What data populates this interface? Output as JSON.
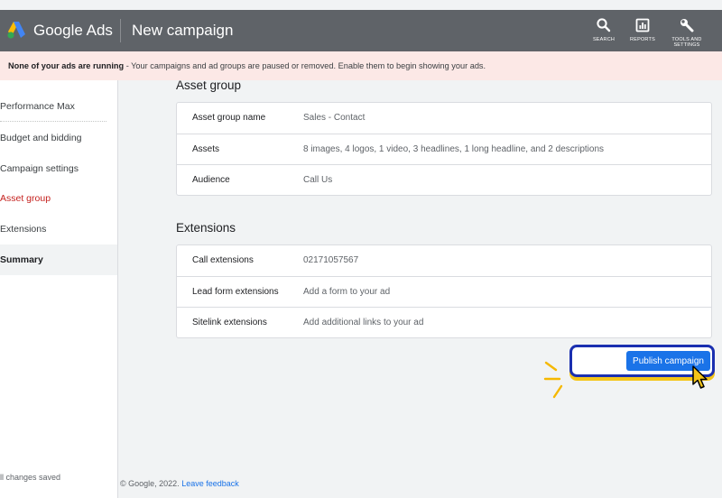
{
  "header": {
    "brand": "Google Ads",
    "page_title": "New campaign",
    "tools": [
      {
        "icon": "search-icon",
        "label": "SEARCH"
      },
      {
        "icon": "reports-icon",
        "label": "REPORTS"
      },
      {
        "icon": "wrench-icon",
        "label_line1": "TOOLS AND",
        "label_line2": "SETTINGS"
      }
    ]
  },
  "banner": {
    "bold": "None of your ads are running",
    "text": " - Your campaigns and ad groups are paused or removed. Enable them to begin showing your ads."
  },
  "sidebar": {
    "items": [
      {
        "label": "Performance Max"
      },
      {
        "label": "Budget and bidding"
      },
      {
        "label": "Campaign settings"
      },
      {
        "label": "Asset group"
      },
      {
        "label": "Extensions"
      },
      {
        "label": "Summary"
      }
    ],
    "saved": "ll changes saved"
  },
  "asset_group": {
    "title": "Asset group",
    "rows": [
      {
        "key": "Asset group name",
        "value": "Sales - Contact"
      },
      {
        "key": "Assets",
        "value": "8 images, 4 logos, 1 video, 3 headlines, 1 long headline, and 2 descriptions"
      },
      {
        "key": "Audience",
        "value": "Call Us"
      }
    ]
  },
  "extensions": {
    "title": "Extensions",
    "rows": [
      {
        "key": "Call extensions",
        "value": "02171057567"
      },
      {
        "key": "Lead form extensions",
        "value": "Add a form to your ad"
      },
      {
        "key": "Sitelink extensions",
        "value": "Add additional links to your ad"
      }
    ]
  },
  "publish_label": "Publish campaign",
  "footer": {
    "copyright": "© Google, 2022.",
    "link": "Leave feedback"
  },
  "colors": {
    "topbar": "#5f6368",
    "banner": "#fce8e6",
    "primary": "#1a73e8",
    "active_nav": "#c5221f",
    "highlight_border": "#1a2fb0",
    "highlight_shadow": "#f5c518"
  }
}
